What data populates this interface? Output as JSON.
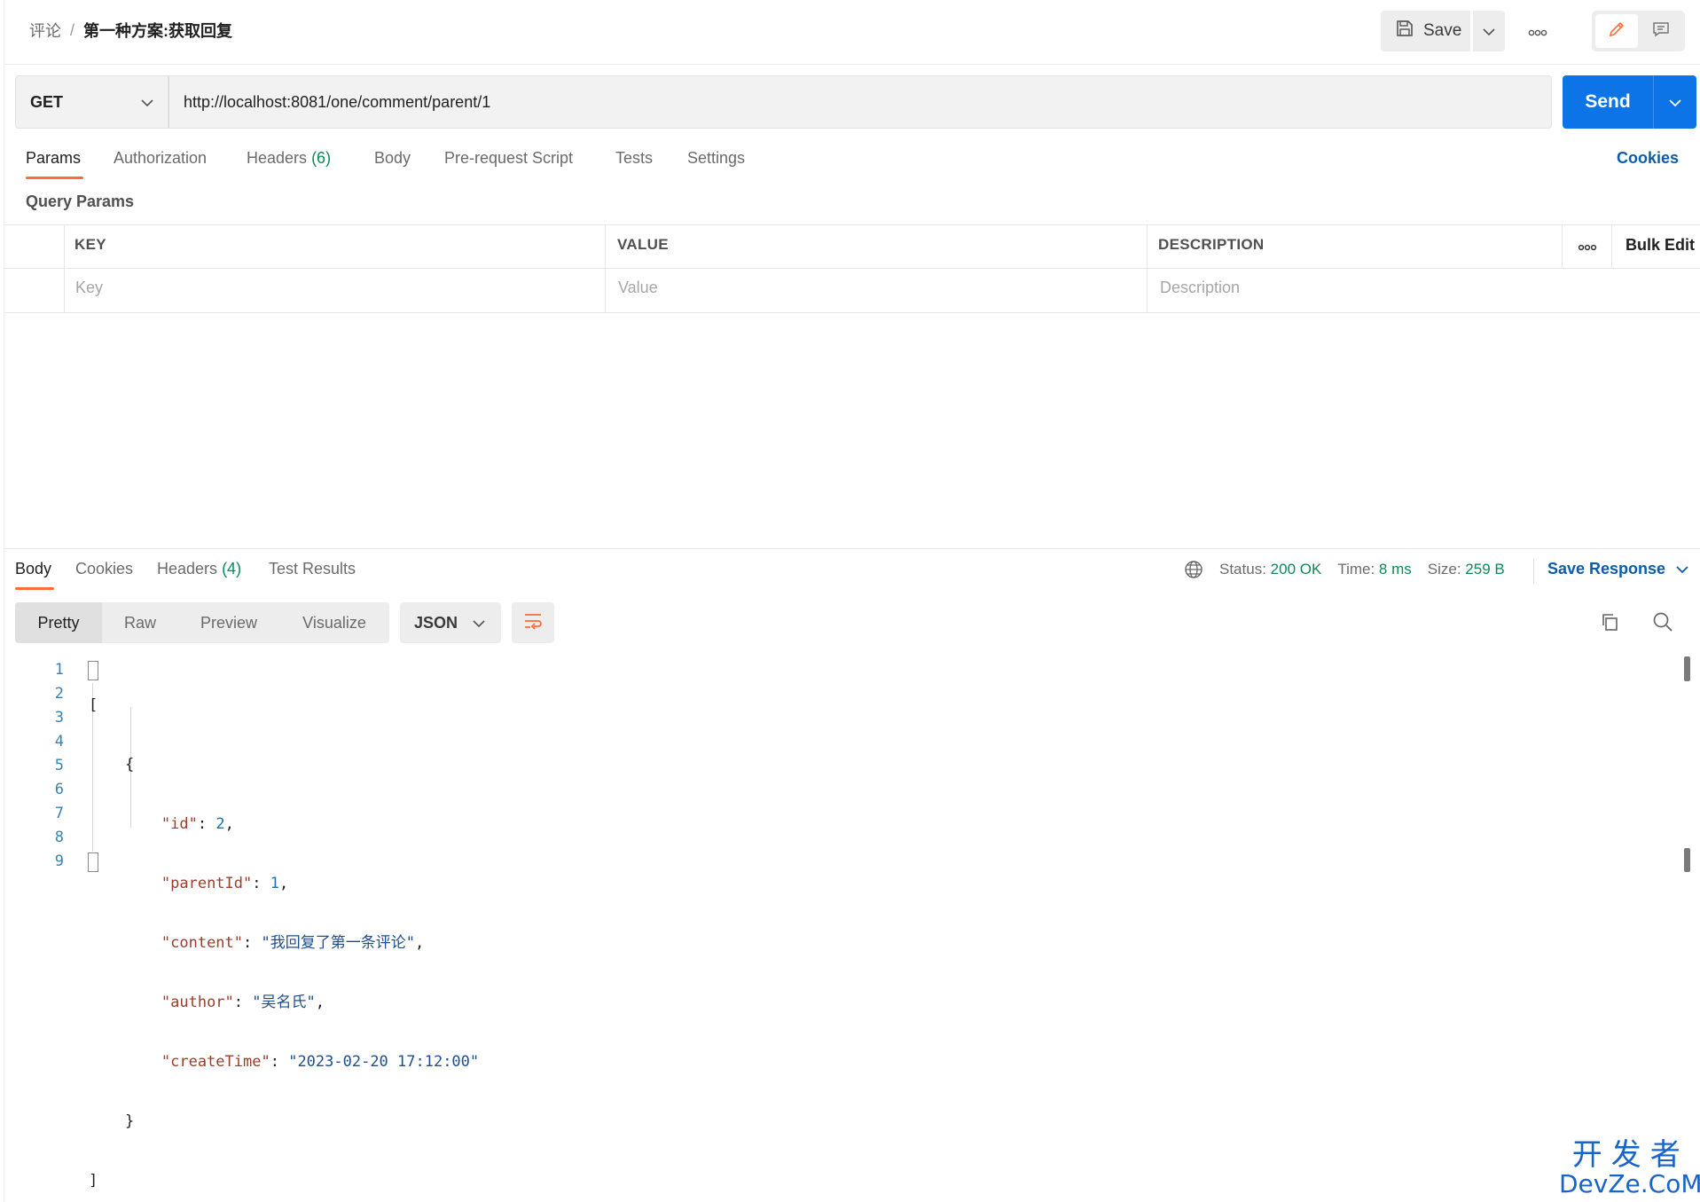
{
  "header": {
    "breadcrumb_parent": "评论",
    "breadcrumb_separator": "/",
    "breadcrumb_current": "第一种方案:获取回复",
    "save_label": "Save"
  },
  "request": {
    "method": "GET",
    "url": "http://localhost:8081/one/comment/parent/1",
    "send_label": "Send"
  },
  "request_tabs": [
    {
      "label": "Params",
      "count": ""
    },
    {
      "label": "Authorization",
      "count": ""
    },
    {
      "label": "Headers",
      "count": "(6)"
    },
    {
      "label": "Body",
      "count": ""
    },
    {
      "label": "Pre-request Script",
      "count": ""
    },
    {
      "label": "Tests",
      "count": ""
    },
    {
      "label": "Settings",
      "count": ""
    }
  ],
  "cookies_label": "Cookies",
  "query_params": {
    "title": "Query Params",
    "columns": [
      "KEY",
      "VALUE",
      "DESCRIPTION"
    ],
    "bulk_edit": "Bulk Edit",
    "placeholders": {
      "key": "Key",
      "value": "Value",
      "description": "Description"
    }
  },
  "response_tabs": [
    {
      "label": "Body",
      "count": ""
    },
    {
      "label": "Cookies",
      "count": ""
    },
    {
      "label": "Headers",
      "count": "(4)"
    },
    {
      "label": "Test Results",
      "count": ""
    }
  ],
  "response_meta": {
    "status_label": "Status:",
    "status_value": "200 OK",
    "time_label": "Time:",
    "time_value": "8 ms",
    "size_label": "Size:",
    "size_value": "259 B",
    "save_response": "Save Response"
  },
  "view_modes": [
    "Pretty",
    "Raw",
    "Preview",
    "Visualize"
  ],
  "format": "JSON",
  "code": {
    "line_numbers": [
      "1",
      "2",
      "3",
      "4",
      "5",
      "6",
      "7",
      "8",
      "9"
    ],
    "open_bracket": "[",
    "open_brace": "{",
    "fields": [
      {
        "key": "\"id\"",
        "value": "2",
        "type": "number",
        "comma": ","
      },
      {
        "key": "\"parentId\"",
        "value": "1",
        "type": "number",
        "comma": ","
      },
      {
        "key": "\"content\"",
        "value": "\"我回复了第一条评论\"",
        "type": "string",
        "comma": ","
      },
      {
        "key": "\"author\"",
        "value": "\"吴名氏\"",
        "type": "string",
        "comma": ","
      },
      {
        "key": "\"createTime\"",
        "value": "\"2023-02-20 17:12:00\"",
        "type": "string",
        "comma": ""
      }
    ],
    "close_brace": "}",
    "close_bracket": "]"
  },
  "watermark": {
    "cn": "开发者",
    "en": "DevZe.CoM"
  },
  "colors": {
    "accent": "#ff6c37",
    "primary": "#0d74e7",
    "success": "#0c8a56",
    "link": "#0b5cad"
  }
}
